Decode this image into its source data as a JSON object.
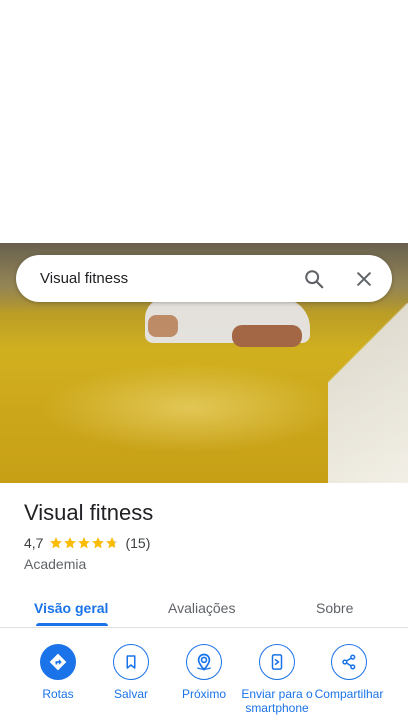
{
  "search": {
    "query": "Visual fitness"
  },
  "place": {
    "name": "Visual fitness",
    "rating": "4,7",
    "stars": 4.7,
    "reviews": "(15)",
    "category": "Academia"
  },
  "tabs": [
    {
      "label": "Visão geral",
      "active": true
    },
    {
      "label": "Avaliações",
      "active": false
    },
    {
      "label": "Sobre",
      "active": false
    }
  ],
  "actions": [
    {
      "label": "Rotas",
      "icon": "directions-icon"
    },
    {
      "label": "Salvar",
      "icon": "bookmark-icon"
    },
    {
      "label": "Próximo",
      "icon": "nearby-icon"
    },
    {
      "label": "Enviar para o smartphone",
      "icon": "send-to-phone-icon"
    },
    {
      "label": "Compartilhar",
      "icon": "share-icon"
    }
  ],
  "colors": {
    "accent": "#1a73e8",
    "star": "#fbbc04",
    "text": "#202124",
    "muted": "#5f6368"
  }
}
